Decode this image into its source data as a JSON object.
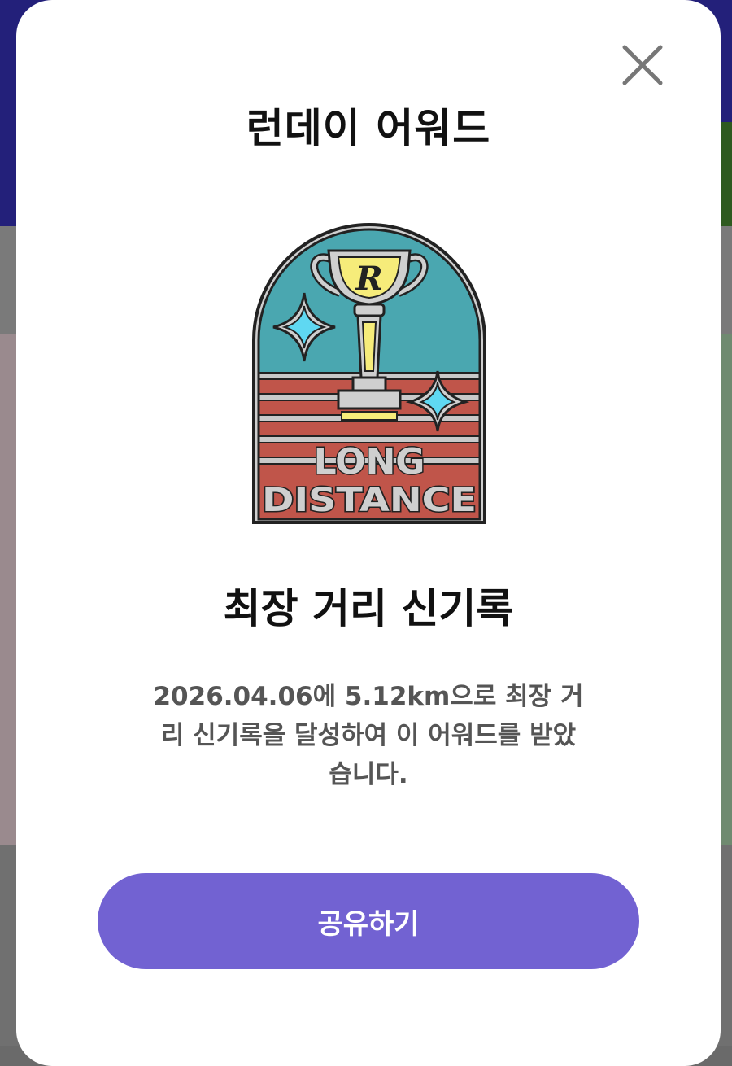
{
  "modal": {
    "title": "런데이 어워드",
    "close_icon": "close-icon",
    "badge": {
      "icon": "long-distance-trophy-badge",
      "text_line1": "LONG",
      "text_line2": "DISTANCE",
      "trophy_letter": "R",
      "colors": {
        "sky": "#4aa7b0",
        "track": "#c0554a",
        "trophy": "#f6ec7a",
        "sparkle": "#5fd8f2",
        "frame": "#b9b9b9"
      }
    },
    "award_name": "최장 거리 신기록",
    "description": "2026.04.06에 5.12km으로 최장 거리 신기록을 달성하여 이 어워드를 받았습니다.",
    "share_label": "공유하기",
    "accent_color": "#7262d2"
  }
}
